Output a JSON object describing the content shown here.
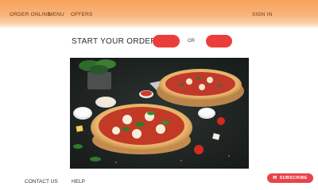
{
  "nav": {
    "order_online": "ORDER ONLINE",
    "menu": "MENU",
    "offers": "OFFERS",
    "sign_in": "SIGN IN"
  },
  "start": {
    "title": "START YOUR ORDER",
    "delivery_label": "",
    "or_label": "OR",
    "carryout_label": ""
  },
  "footer": {
    "contact_us": "CONTACT US",
    "help": "HELP",
    "subscribe": "SUBSCRIBE"
  },
  "colors": {
    "nav_gradient_top": "#f7a25a",
    "accent_red": "#ec3d3d",
    "subscribe_red": "#e8434a"
  },
  "icons": {
    "subscribe": "envelope-icon"
  }
}
